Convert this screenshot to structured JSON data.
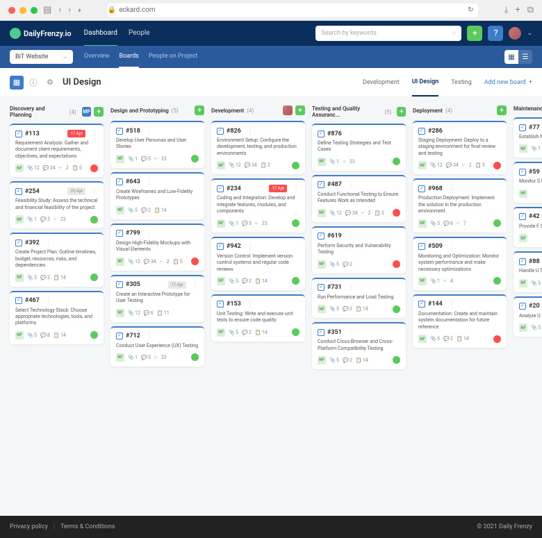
{
  "browser": {
    "url": "eckard.com"
  },
  "app": {
    "logo": "DailyFrenzy.io",
    "nav": [
      "Dashboard",
      "People"
    ],
    "active_nav": 0,
    "search_placeholder": "Search by keywords"
  },
  "project": {
    "name": "BiT Website",
    "sub_nav": [
      "Overview",
      "Boards",
      "People on Project"
    ],
    "active_sub": 1
  },
  "page": {
    "title": "UI Design",
    "tabs": [
      "Development",
      "UI Design",
      "Testing"
    ],
    "active_tab": 1,
    "add_label": "Add new board"
  },
  "columns": [
    {
      "title": "Discovery and Planning",
      "count": 4,
      "badge": "MP",
      "badge_type": "user",
      "cards": [
        {
          "id": "#113",
          "date": "17 Apr",
          "date_style": "red",
          "body": "Requirement Analysis: Gather and document client requirements, objectives, and expectations",
          "stats": {
            "a": 12,
            "c": 34,
            "b": 2,
            "p": 5
          },
          "status": "red"
        },
        {
          "id": "#254",
          "date": "25 Apr",
          "date_style": "grey",
          "body": "Feasibility Study: Assess the technical and financial feasibility of the project",
          "stats": {
            "a": 1,
            "c": 5,
            "b": 23
          },
          "status": "green"
        },
        {
          "id": "#392",
          "body": "Create Project Plan: Outline timelines, budget, resources, risks, and dependencies",
          "stats": {
            "a": 5,
            "c": 2,
            "p": 14
          },
          "status": "green"
        },
        {
          "id": "#467",
          "body": "Select Technology Stack: Choose appropriate technologies, tools, and platforms",
          "stats": {
            "a": 5,
            "c": 8,
            "p": 14
          },
          "status": "green"
        }
      ]
    },
    {
      "title": "Design and Prototyping",
      "count": 5,
      "badge_type": "add",
      "cards": [
        {
          "id": "#518",
          "body": "Develop User Personas and User Stories",
          "stats": {
            "a": 1,
            "c": 5,
            "b": 23
          },
          "status": "green"
        },
        {
          "id": "#643",
          "body": "Create Wireframes and Low-Fidelity Prototypes",
          "stats": {
            "a": 5,
            "c": 2,
            "p": 14
          },
          "status": ""
        },
        {
          "id": "#799",
          "body": "Design High-Fidelity Mockups with Visual Elements",
          "stats": {
            "a": 12,
            "c": 34,
            "b": 2,
            "p": 5
          },
          "status": "red"
        },
        {
          "id": "#305",
          "date": "17 Apr",
          "date_style": "grey",
          "body": "Create an Interactive Prototype for User Testing",
          "stats": {
            "a": 12,
            "c": 6,
            "p": 11
          },
          "status": ""
        },
        {
          "id": "#712",
          "body": "Conduct User Experience (UX) Testing",
          "stats": {
            "a": 1,
            "c": 5,
            "b": 23
          },
          "status": "green"
        }
      ]
    },
    {
      "title": "Development",
      "count": 4,
      "badge_type": "avatar",
      "cards": [
        {
          "id": "#826",
          "body": "Environment Setup: Configure the development, testing, and production environments",
          "stats": {
            "a": 12,
            "c": 34,
            "p": 2
          },
          "status": "green"
        },
        {
          "id": "#234",
          "date": "17 Apr",
          "date_style": "red",
          "body": "Coding and Integration: Develop and integrate features, modules, and components",
          "stats": {
            "a": 1,
            "c": 5,
            "b": 23
          },
          "status": "green"
        },
        {
          "id": "#942",
          "body": "Version Control: Implement version control systems and regular code reviews",
          "stats": {
            "a": 5,
            "c": 2,
            "p": 14
          },
          "status": "green"
        },
        {
          "id": "#153",
          "body": "Unit Testing: Write and execute unit tests to ensure code quality",
          "stats": {
            "a": 5,
            "c": 2,
            "p": 14
          },
          "status": "green"
        }
      ]
    },
    {
      "title": "Testing and Quality Assuranc...",
      "count": 5,
      "badge_type": "add",
      "cards": [
        {
          "id": "#876",
          "body": "Define Testing Strategies and Test Cases",
          "stats": {
            "a": 1,
            "b": 23
          },
          "status": "green"
        },
        {
          "id": "#487",
          "body": "Conduct Functional Testing to Ensure Features Work as Intended",
          "stats": {
            "a": 12,
            "c": 34,
            "b": 2,
            "p": 5
          },
          "status": "red"
        },
        {
          "id": "#619",
          "body": "Perform Security and Vulnerability Testing",
          "stats": {
            "a": 5,
            "c": 2
          },
          "status": "red"
        },
        {
          "id": "#731",
          "body": "Run Performance and Load Testing",
          "stats": {
            "a": 5,
            "c": 2,
            "p": 14
          },
          "status": "green"
        },
        {
          "id": "#351",
          "body": "Conduct Cross-Browser and Cross-Platform Compatibility Testing",
          "stats": {
            "a": 5,
            "c": 2,
            "p": 14
          },
          "status": "green"
        }
      ]
    },
    {
      "title": "Deployment",
      "count": 4,
      "badge_type": "add",
      "cards": [
        {
          "id": "#286",
          "body": "Staging Deployment: Deploy to a staging environment for final review and testing",
          "stats": {
            "a": 12,
            "c": 34,
            "b": 2,
            "p": 5
          },
          "status": "red"
        },
        {
          "id": "#968",
          "body": "Production Deployment: Implement the solution in the production environment",
          "stats": {
            "a": 5,
            "c": 8,
            "b": 7
          },
          "status": "green"
        },
        {
          "id": "#509",
          "body": "Monitoring and Optimization: Monitor system performance and make necessary optimizations",
          "stats": {
            "a": 1,
            "b": 4
          },
          "status": "green"
        },
        {
          "id": "#144",
          "body": "Documentation: Create and maintain system documentation for future reference",
          "stats": {
            "a": 5,
            "c": 2,
            "p": 14
          },
          "status": "red"
        }
      ]
    },
    {
      "title": "Maintenance",
      "count": "",
      "badge_type": "",
      "cards": [
        {
          "id": "#77",
          "body": "Establish Maintenanc",
          "stats": {
            "a": 1
          },
          "status": ""
        },
        {
          "id": "#59",
          "body": "Monitor S User Fee",
          "stats": {},
          "status": ""
        },
        {
          "id": "#42",
          "body": "Provide F Security L",
          "stats": {},
          "status": ""
        },
        {
          "id": "#88",
          "body": "Handle U Tickets",
          "stats": {
            "a": 5
          },
          "status": ""
        },
        {
          "id": "#20",
          "body": "Analyze U Insights",
          "stats": {
            "a": 5
          },
          "status": ""
        }
      ]
    }
  ],
  "footer": {
    "privacy": "Privacy policy",
    "terms": "Terms & Conditions",
    "copy": "© 2021 Daily Frenzy"
  }
}
